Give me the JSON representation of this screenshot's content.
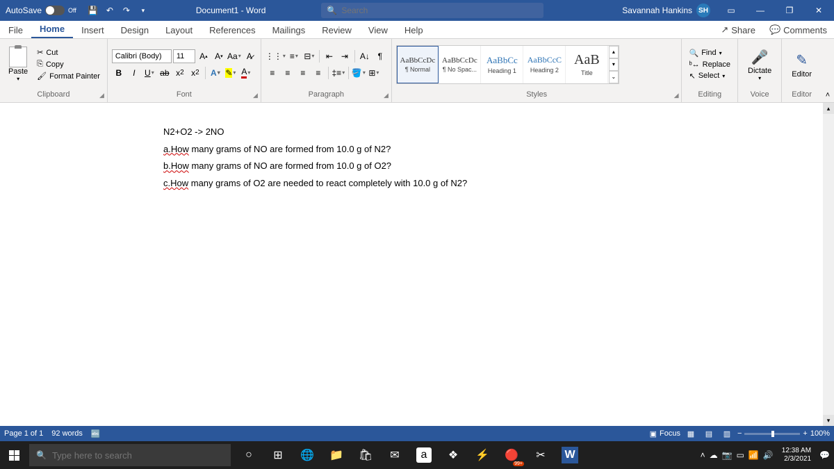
{
  "titlebar": {
    "autosave_label": "AutoSave",
    "autosave_state": "Off",
    "doc_title": "Document1 - Word",
    "search_placeholder": "Search",
    "user_name": "Savannah Hankins",
    "user_initials": "SH"
  },
  "tabs": {
    "items": [
      "File",
      "Home",
      "Insert",
      "Design",
      "Layout",
      "References",
      "Mailings",
      "Review",
      "View",
      "Help"
    ],
    "active": "Home",
    "share": "Share",
    "comments": "Comments"
  },
  "ribbon": {
    "clipboard": {
      "label": "Clipboard",
      "paste": "Paste",
      "cut": "Cut",
      "copy": "Copy",
      "format_painter": "Format Painter"
    },
    "font": {
      "label": "Font",
      "name": "Calibri (Body)",
      "size": "11"
    },
    "paragraph": {
      "label": "Paragraph"
    },
    "styles": {
      "label": "Styles",
      "items": [
        {
          "preview": "AaBbCcDc",
          "name": "¶ Normal",
          "size": "11px"
        },
        {
          "preview": "AaBbCcDc",
          "name": "¶ No Spac...",
          "size": "11px"
        },
        {
          "preview": "AaBbCc",
          "name": "Heading 1",
          "size": "13px",
          "color": "#2e74b5"
        },
        {
          "preview": "AaBbCcC",
          "name": "Heading 2",
          "size": "12px",
          "color": "#2e74b5"
        },
        {
          "preview": "AaB",
          "name": "Title",
          "size": "20px"
        }
      ]
    },
    "editing": {
      "label": "Editing",
      "find": "Find",
      "replace": "Replace",
      "select": "Select"
    },
    "voice": {
      "label": "Voice",
      "dictate": "Dictate"
    },
    "editor": {
      "label": "Editor",
      "btn": "Editor"
    }
  },
  "document": {
    "lines": [
      {
        "pre": "",
        "text": "N2+O2 -> 2NO"
      },
      {
        "pre": "a.How",
        "text": " many grams of NO are formed from 10.0 g of N2?"
      },
      {
        "pre": "b.How",
        "text": " many grams of NO are formed from 10.0 g of O2?"
      },
      {
        "pre": "c.How",
        "text": " many grams of O2 are needed to react completely with 10.0 g of N2?"
      }
    ]
  },
  "statusbar": {
    "page": "Page 1 of 1",
    "words": "92 words",
    "focus": "Focus",
    "zoom": "100%"
  },
  "taskbar": {
    "search_placeholder": "Type here to search",
    "time": "12:38 AM",
    "date": "2/3/2021"
  }
}
